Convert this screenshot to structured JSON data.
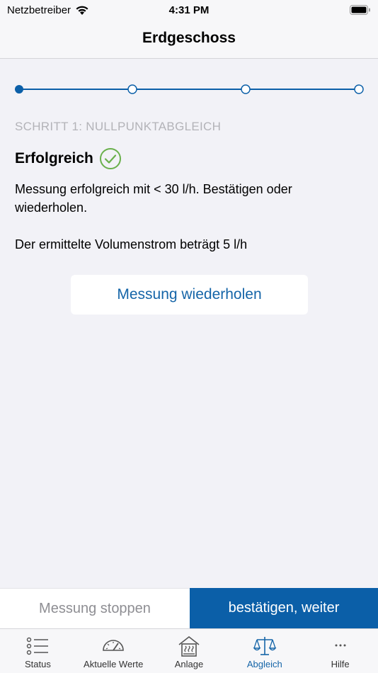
{
  "status_bar": {
    "carrier": "Netzbetreiber",
    "time": "4:31 PM"
  },
  "nav": {
    "title": "Erdgeschoss"
  },
  "stepper": {
    "total_steps": 4,
    "current_step": 1
  },
  "step": {
    "label": "SCHRITT 1: NULLPUNKTABGLEICH",
    "result_title": "Erfolgreich",
    "message": "Messung erfolgreich mit < 30 l/h. Bestätigen oder wiederholen.",
    "volume_text": "Der ermittelte Volumenstrom beträgt 5 l/h",
    "repeat_button": "Messung wiederholen"
  },
  "actions": {
    "stop_label": "Messung stoppen",
    "confirm_label": "bestätigen, weiter"
  },
  "tabs": [
    {
      "label": "Status",
      "icon": "list-icon",
      "active": false
    },
    {
      "label": "Aktuelle Werte",
      "icon": "gauge-icon",
      "active": false
    },
    {
      "label": "Anlage",
      "icon": "house-heating-icon",
      "active": false
    },
    {
      "label": "Abgleich",
      "icon": "scale-icon",
      "active": true
    },
    {
      "label": "Hilfe",
      "icon": "more-icon",
      "active": false
    }
  ],
  "colors": {
    "accent": "#0b5fa8",
    "link": "#1565a8",
    "success": "#6ab04c"
  }
}
